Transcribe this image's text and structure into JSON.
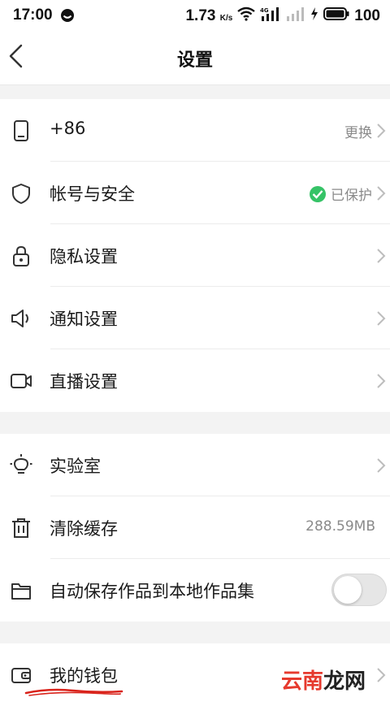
{
  "status_bar": {
    "time": "17:00",
    "speed": "1.73",
    "speed_unit": "K/s",
    "network": "4G",
    "battery": "100"
  },
  "header": {
    "title": "设置"
  },
  "sections": [
    {
      "items": [
        {
          "icon": "phone-icon",
          "label": "+86",
          "value": "更换",
          "chevron": true
        },
        {
          "icon": "shield-icon",
          "label": "帐号与安全",
          "value": "已保护",
          "status_icon": "check-circle-icon",
          "status_color": "#36c367",
          "chevron": true
        },
        {
          "icon": "lock-icon",
          "label": "隐私设置",
          "chevron": true
        },
        {
          "icon": "speaker-icon",
          "label": "通知设置",
          "chevron": true
        },
        {
          "icon": "video-camera-icon",
          "label": "直播设置",
          "chevron": true
        }
      ]
    },
    {
      "items": [
        {
          "icon": "bulb-icon",
          "label": "实验室",
          "chevron": true
        },
        {
          "icon": "trash-icon",
          "label": "清除缓存",
          "value": "288.59MB",
          "chevron": false
        },
        {
          "icon": "folder-icon",
          "label": "自动保存作品到本地作品集",
          "toggle": false
        }
      ]
    },
    {
      "items": [
        {
          "icon": "wallet-icon",
          "label": "我的钱包",
          "chevron": true
        }
      ]
    }
  ],
  "watermark": {
    "part1": "云南",
    "part2": "龙网"
  },
  "colors": {
    "accent_green": "#36c367",
    "annotation_red": "#d9231b",
    "watermark_red": "#e63a2e"
  }
}
